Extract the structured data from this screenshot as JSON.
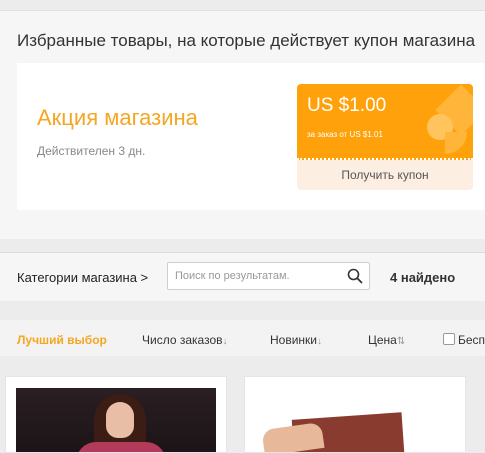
{
  "promo": {
    "title": "Избранные товары, на которые действует купон магазина",
    "name": "Акция магазина",
    "valid": "Действителен 3 дн.",
    "coupon": {
      "amount": "US $1.00",
      "condition": "за заказ от US $1.01",
      "button_label": "Получить купон"
    }
  },
  "filter": {
    "categories_label": "Категории магазина >",
    "search_placeholder": "Поиск по результатам.",
    "found": "4 найдено"
  },
  "sort": {
    "best": "Лучший выбор",
    "orders": "Число заказов",
    "new": "Новинки",
    "price": "Цена",
    "free_shipping": "Бесп"
  },
  "colors": {
    "accent": "#f5a623",
    "coupon": "#ffa10a"
  }
}
